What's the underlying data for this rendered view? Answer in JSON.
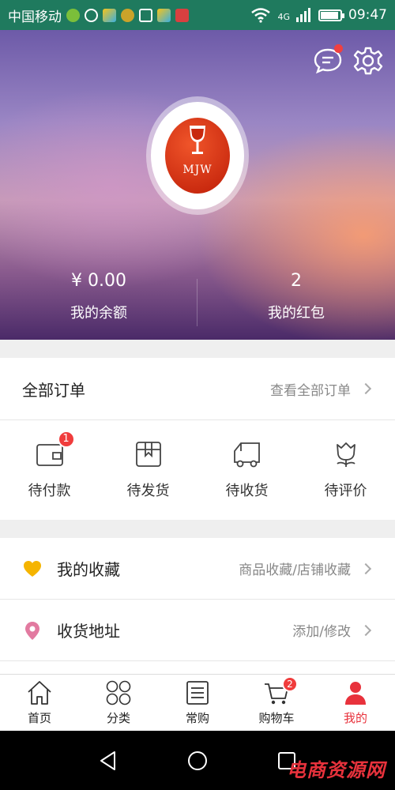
{
  "status_bar": {
    "carrier": "中国移动",
    "network": "4G",
    "time": "09:47",
    "battery_level": 0.9
  },
  "header": {
    "logo_text": "MJW",
    "balance": {
      "value": "¥ 0.00",
      "label": "我的余额"
    },
    "red_packet": {
      "value": "2",
      "label": "我的红包"
    }
  },
  "orders": {
    "title": "全部订单",
    "view_all": "查看全部订单",
    "items": [
      {
        "label": "待付款",
        "icon": "wallet-icon",
        "badge": "1"
      },
      {
        "label": "待发货",
        "icon": "box-icon"
      },
      {
        "label": "待收货",
        "icon": "truck-icon"
      },
      {
        "label": "待评价",
        "icon": "flower-icon"
      }
    ]
  },
  "favorites": {
    "title": "我的收藏",
    "detail": "商品收藏/店铺收藏",
    "icon": "heart-icon",
    "color": "#f5b400"
  },
  "address": {
    "title": "收货地址",
    "detail": "添加/修改",
    "icon": "location-pin-icon",
    "color": "#e27aa0"
  },
  "tabs": [
    {
      "label": "首页",
      "icon": "home-icon"
    },
    {
      "label": "分类",
      "icon": "grid-icon"
    },
    {
      "label": "常购",
      "icon": "list-icon"
    },
    {
      "label": "购物车",
      "icon": "cart-icon",
      "badge": "2"
    },
    {
      "label": "我的",
      "icon": "user-icon",
      "active": true
    }
  ],
  "watermark": "电商资源网",
  "colors": {
    "accent": "#e8323c",
    "status_bar": "#1f7a5e"
  }
}
